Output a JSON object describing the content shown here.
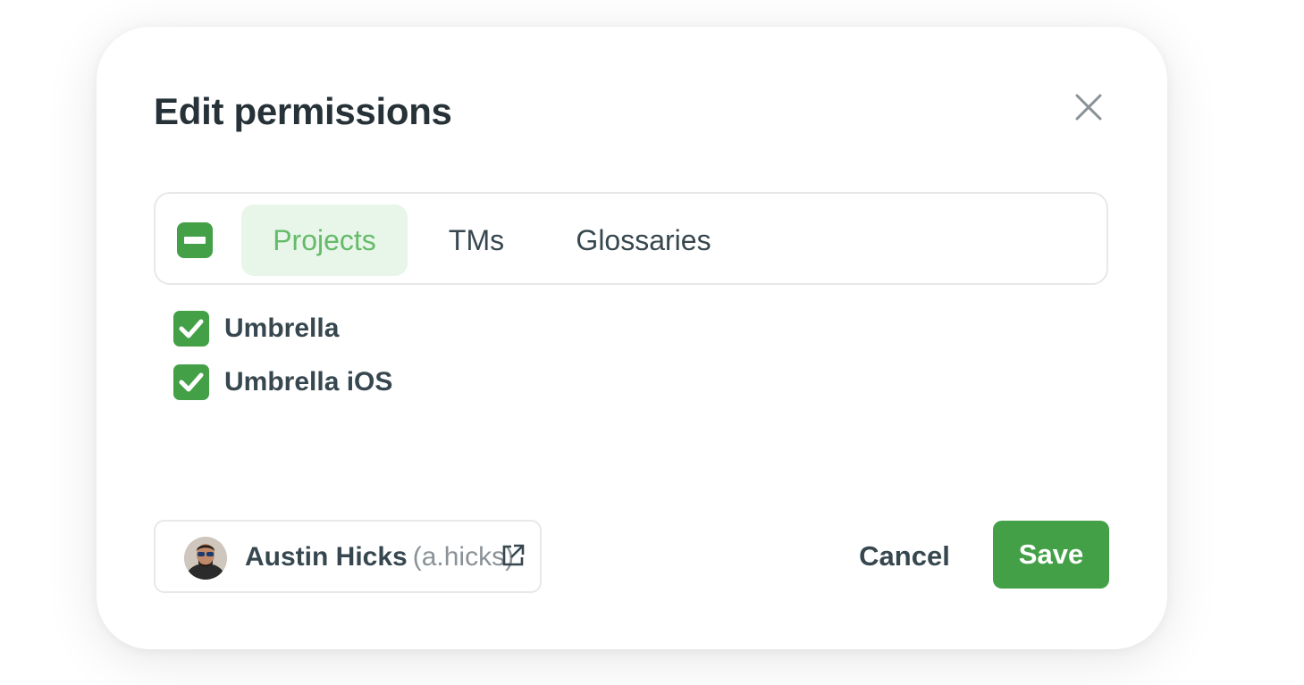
{
  "dialog": {
    "title": "Edit permissions",
    "close_icon": "close-icon"
  },
  "tabs": {
    "master_checkbox_state": "indeterminate",
    "items": [
      {
        "label": "Projects",
        "active": true
      },
      {
        "label": "TMs",
        "active": false
      },
      {
        "label": "Glossaries",
        "active": false
      }
    ]
  },
  "projects": [
    {
      "label": "Umbrella",
      "checked": true
    },
    {
      "label": "Umbrella iOS",
      "checked": true
    }
  ],
  "user": {
    "name": "Austin Hicks",
    "handle": "(a.hicks)",
    "avatar_icon": "avatar",
    "link_icon": "external-link-icon"
  },
  "footer": {
    "cancel_label": "Cancel",
    "save_label": "Save"
  },
  "colors": {
    "accent": "#43a047",
    "active_tab_bg": "#e8f5e9",
    "active_tab_text": "#66bb6a",
    "text": "#37474f"
  }
}
